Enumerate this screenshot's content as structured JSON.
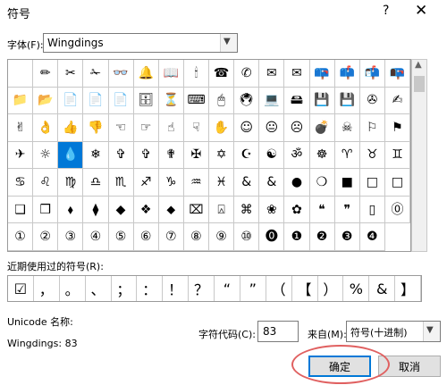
{
  "dialog": {
    "title": "符号",
    "help": "?",
    "close": "✕",
    "font_label": "字体(F):",
    "font_value": "Wingdings",
    "symbols": [
      "",
      "✏",
      "✂",
      "✁",
      "👓",
      "🔔",
      "📖",
      "🕯",
      "☎",
      "✆",
      "✉",
      "✉",
      "📪",
      "📫",
      "📬",
      "📭",
      "📁",
      "📂",
      "📄",
      "📄",
      "📄",
      "🗄",
      "⏳",
      "⌨",
      "🖱",
      "🖲",
      "💻",
      "🖴",
      "💾",
      "💾",
      "✇",
      "✍",
      "✌",
      "👌",
      "👍",
      "👎",
      "☜",
      "☞",
      "☝",
      "☟",
      "✋",
      "☺",
      "😐",
      "☹",
      "💣",
      "☠",
      "⚐",
      "⚑",
      "✈",
      "☼",
      "💧",
      "❄",
      "✞",
      "✞",
      "✟",
      "✠",
      "✡",
      "☪",
      "☯",
      "ॐ",
      "☸",
      "♈",
      "♉",
      "♊",
      "♋",
      "♌",
      "♍",
      "♎",
      "♏",
      "♐",
      "♑",
      "♒",
      "♓",
      "&",
      "&",
      "●",
      "❍",
      "■",
      "□",
      "□",
      "❑",
      "❒",
      "⬧",
      "⧫",
      "◆",
      "❖",
      "⬥",
      "⌧",
      "⍓",
      "⌘",
      "❀",
      "✿",
      "❝",
      "❞",
      "▯",
      "⓪",
      "①",
      "②",
      "③",
      "④",
      "⑤",
      "⑥",
      "⑦",
      "⑧",
      "⑨",
      "⑩",
      "⓿",
      "❶",
      "❷",
      "❸",
      "❹"
    ],
    "selected_index": 50,
    "recent_label": "近期使用过的符号(R):",
    "recent": [
      "☑",
      "，",
      "。",
      "、",
      "；",
      "：",
      "！",
      "？",
      "“",
      "”",
      "（",
      "【",
      "）",
      "%",
      "&",
      "】"
    ],
    "unicode_name_label": "Unicode 名称:",
    "char_name": "Wingdings: 83",
    "code_label": "字符代码(C):",
    "code_value": "83",
    "from_label": "来自(M):",
    "from_value": "符号(十进制)",
    "ok_label": "确定",
    "cancel_label": "取消"
  }
}
